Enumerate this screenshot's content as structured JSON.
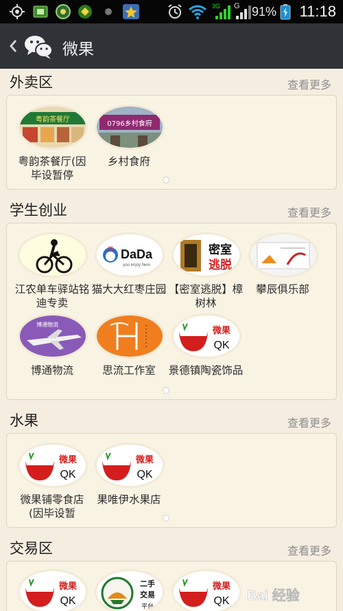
{
  "status_bar": {
    "battery_percent": "91%",
    "time": "11:18",
    "network_3g": "3G",
    "network_g": "G"
  },
  "header": {
    "title": "微果"
  },
  "sections": [
    {
      "title": "外卖区",
      "more": "查看更多",
      "items": [
        {
          "label": "粤韵茶餐厅(因毕设暂停"
        },
        {
          "label": "乡村食府"
        }
      ]
    },
    {
      "title": "学生创业",
      "more": "查看更多",
      "items": [
        {
          "label": "江农单车驿站铭迪专卖"
        },
        {
          "label": "猫大大红枣庄园"
        },
        {
          "label": "【密室逃脱】樟树林"
        },
        {
          "label": "攀辰俱乐部"
        },
        {
          "label": "博通物流"
        },
        {
          "label": "思流工作室"
        },
        {
          "label": "景德镇陶瓷饰品"
        }
      ]
    },
    {
      "title": "水果",
      "more": "查看更多",
      "items": [
        {
          "label": "微果铺零食店(因毕设暂"
        },
        {
          "label": "果唯伊水果店"
        }
      ]
    },
    {
      "title": "交易区",
      "more": "查看更多",
      "items": [
        {
          "label": ""
        },
        {
          "label": ""
        },
        {
          "label": ""
        }
      ]
    }
  ],
  "thumb_text": {
    "yueyun_sign": "粤韵茶餐厅",
    "xiangcun_sign": "0796乡村食府",
    "dada_logo": "DaDa",
    "dada_sub": "you enjoy here",
    "dada_cat": "猫",
    "mishi_1": "密室",
    "mishi_2": "逃脱",
    "botong": "博通物流",
    "weiguo_1": "微果",
    "weiguo_2": "QK",
    "ershou_1": "二手",
    "ershou_2": "交易",
    "ershou_3": "平台"
  },
  "watermark": "Bai 经验"
}
